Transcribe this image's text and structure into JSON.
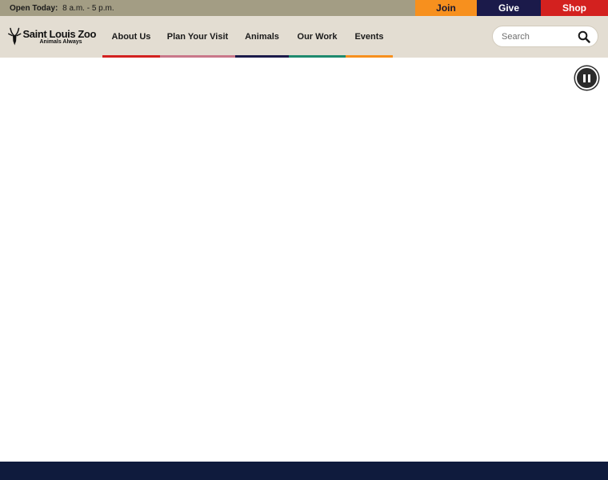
{
  "utility": {
    "hours_label": "Open Today:",
    "hours_value": "8 a.m. - 5 p.m.",
    "join_label": "Join",
    "give_label": "Give",
    "shop_label": "Shop"
  },
  "brand": {
    "name": "Saint Louis Zoo",
    "tagline": "Animals Always",
    "logo_icon": "antelope-head-icon"
  },
  "nav": {
    "items": [
      {
        "label": "About Us",
        "accent": "#d3211f"
      },
      {
        "label": "Plan Your Visit",
        "accent": "#c9778a"
      },
      {
        "label": "Animals",
        "accent": "#1b1a4a"
      },
      {
        "label": "Our Work",
        "accent": "#1e8a6e"
      },
      {
        "label": "Events",
        "accent": "#f7901e"
      }
    ]
  },
  "search": {
    "placeholder": "Search",
    "icon": "search-icon"
  },
  "hero": {
    "control_icon": "pause-icon"
  },
  "colors": {
    "utility_bar": "#a39d84",
    "header_bg": "#e3ddd2",
    "join": "#f7901e",
    "give": "#1b1a4a",
    "shop": "#d3211f",
    "footer": "#0f1b3d"
  }
}
